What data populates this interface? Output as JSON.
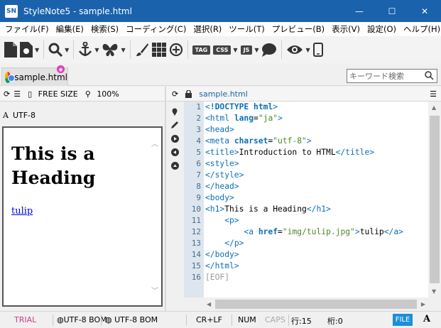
{
  "window": {
    "app_icon_label": "SN",
    "title": "StyleNote5 - sample.html",
    "minimize_glyph": "—",
    "maximize_glyph": "☐",
    "close_glyph": "✕"
  },
  "menu": {
    "items": [
      "ファイル(F)",
      "編集(E)",
      "検索(S)",
      "コーディング(C)",
      "選択(R)",
      "ツール(T)",
      "プレビュー(B)",
      "表示(V)",
      "設定(O)",
      "ヘルプ(H)"
    ]
  },
  "toolbar": {
    "tag_label": "TAG",
    "css_label": "CSS",
    "js_label": "JS",
    "icons": [
      "new-file-icon",
      "open-file-icon",
      "search-icon",
      "anchor-icon",
      "butterfly-icon",
      "brush-icon",
      "grid-icon",
      "add-circle-icon",
      "tag-icon",
      "css-icon",
      "js-icon",
      "comment-icon",
      "eye-icon",
      "mobile-icon"
    ]
  },
  "tabs": {
    "active_file": "sample.html"
  },
  "search": {
    "placeholder": "キーワード検索"
  },
  "preview": {
    "size_label": "FREE SIZE",
    "zoom": "100%",
    "encoding": "UTF-8",
    "heading": "This is a Heading",
    "link_text": "tulip"
  },
  "editor": {
    "filename": "sample.html",
    "line_numbers": [
      "1",
      "2",
      "3",
      "4",
      "5",
      "6",
      "7",
      "8",
      "9",
      "10",
      "11",
      "12",
      "13",
      "14",
      "15",
      "16"
    ],
    "eof": "[EOF]"
  },
  "status": {
    "trial": "TRIAL",
    "encoding_from": "UTF-8 BOM",
    "encoding_to": "UTF-8 BOM",
    "line_ending": "CR+LF",
    "num": "NUM",
    "caps": "CAPS",
    "line": "行:15",
    "col": "桁:0",
    "file_badge": "FILE",
    "font_glyph": "A"
  }
}
